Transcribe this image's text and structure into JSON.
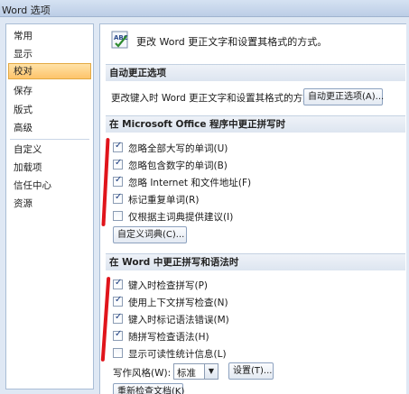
{
  "window": {
    "title": "Word 选项"
  },
  "nav": {
    "items": [
      {
        "id": "common",
        "label": "常用"
      },
      {
        "id": "display",
        "label": "显示"
      },
      {
        "id": "proofing",
        "label": "校对"
      },
      {
        "id": "save",
        "label": "保存"
      },
      {
        "id": "layout",
        "label": "版式"
      },
      {
        "id": "advanced",
        "label": "高级"
      },
      {
        "id": "customize",
        "label": "自定义"
      },
      {
        "id": "addins",
        "label": "加载项"
      },
      {
        "id": "trustcenter",
        "label": "信任中心"
      },
      {
        "id": "resources",
        "label": "资源"
      }
    ],
    "active": "校对"
  },
  "header": {
    "text": "更改 Word 更正文字和设置其格式的方式。",
    "icon": "abc-proofing-icon"
  },
  "autocorrect": {
    "title": "自动更正选项",
    "description": "更改键入时 Word 更正文字和设置其格式的方式:",
    "button": "自动更正选项(A)..."
  },
  "office_spelling": {
    "title": "在 Microsoft Office 程序中更正拼写时",
    "options": [
      {
        "label": "忽略全部大写的单词(U)",
        "checked": true
      },
      {
        "label": "忽略包含数字的单词(B)",
        "checked": true
      },
      {
        "label": "忽略 Internet 和文件地址(F)",
        "checked": true
      },
      {
        "label": "标记重复单词(R)",
        "checked": true
      },
      {
        "label": "仅根据主词典提供建议(I)",
        "checked": false
      }
    ],
    "dict_button": "自定义词典(C)..."
  },
  "word_spelling": {
    "title": "在 Word 中更正拼写和语法时",
    "options": [
      {
        "label": "键入时检查拼写(P)",
        "checked": true
      },
      {
        "label": "使用上下文拼写检查(N)",
        "checked": true
      },
      {
        "label": "键入时标记语法错误(M)",
        "checked": true
      },
      {
        "label": "随拼写检查语法(H)",
        "checked": true
      },
      {
        "label": "显示可读性统计信息(L)",
        "checked": false
      }
    ],
    "style_label": "写作风格(W):",
    "style_value": "标准",
    "settings_button": "设置(T)...",
    "recheck_button": "重新检查文档(K)"
  },
  "colors": {
    "annotation": "#e0141b",
    "nav_active": "#fdc46a"
  }
}
